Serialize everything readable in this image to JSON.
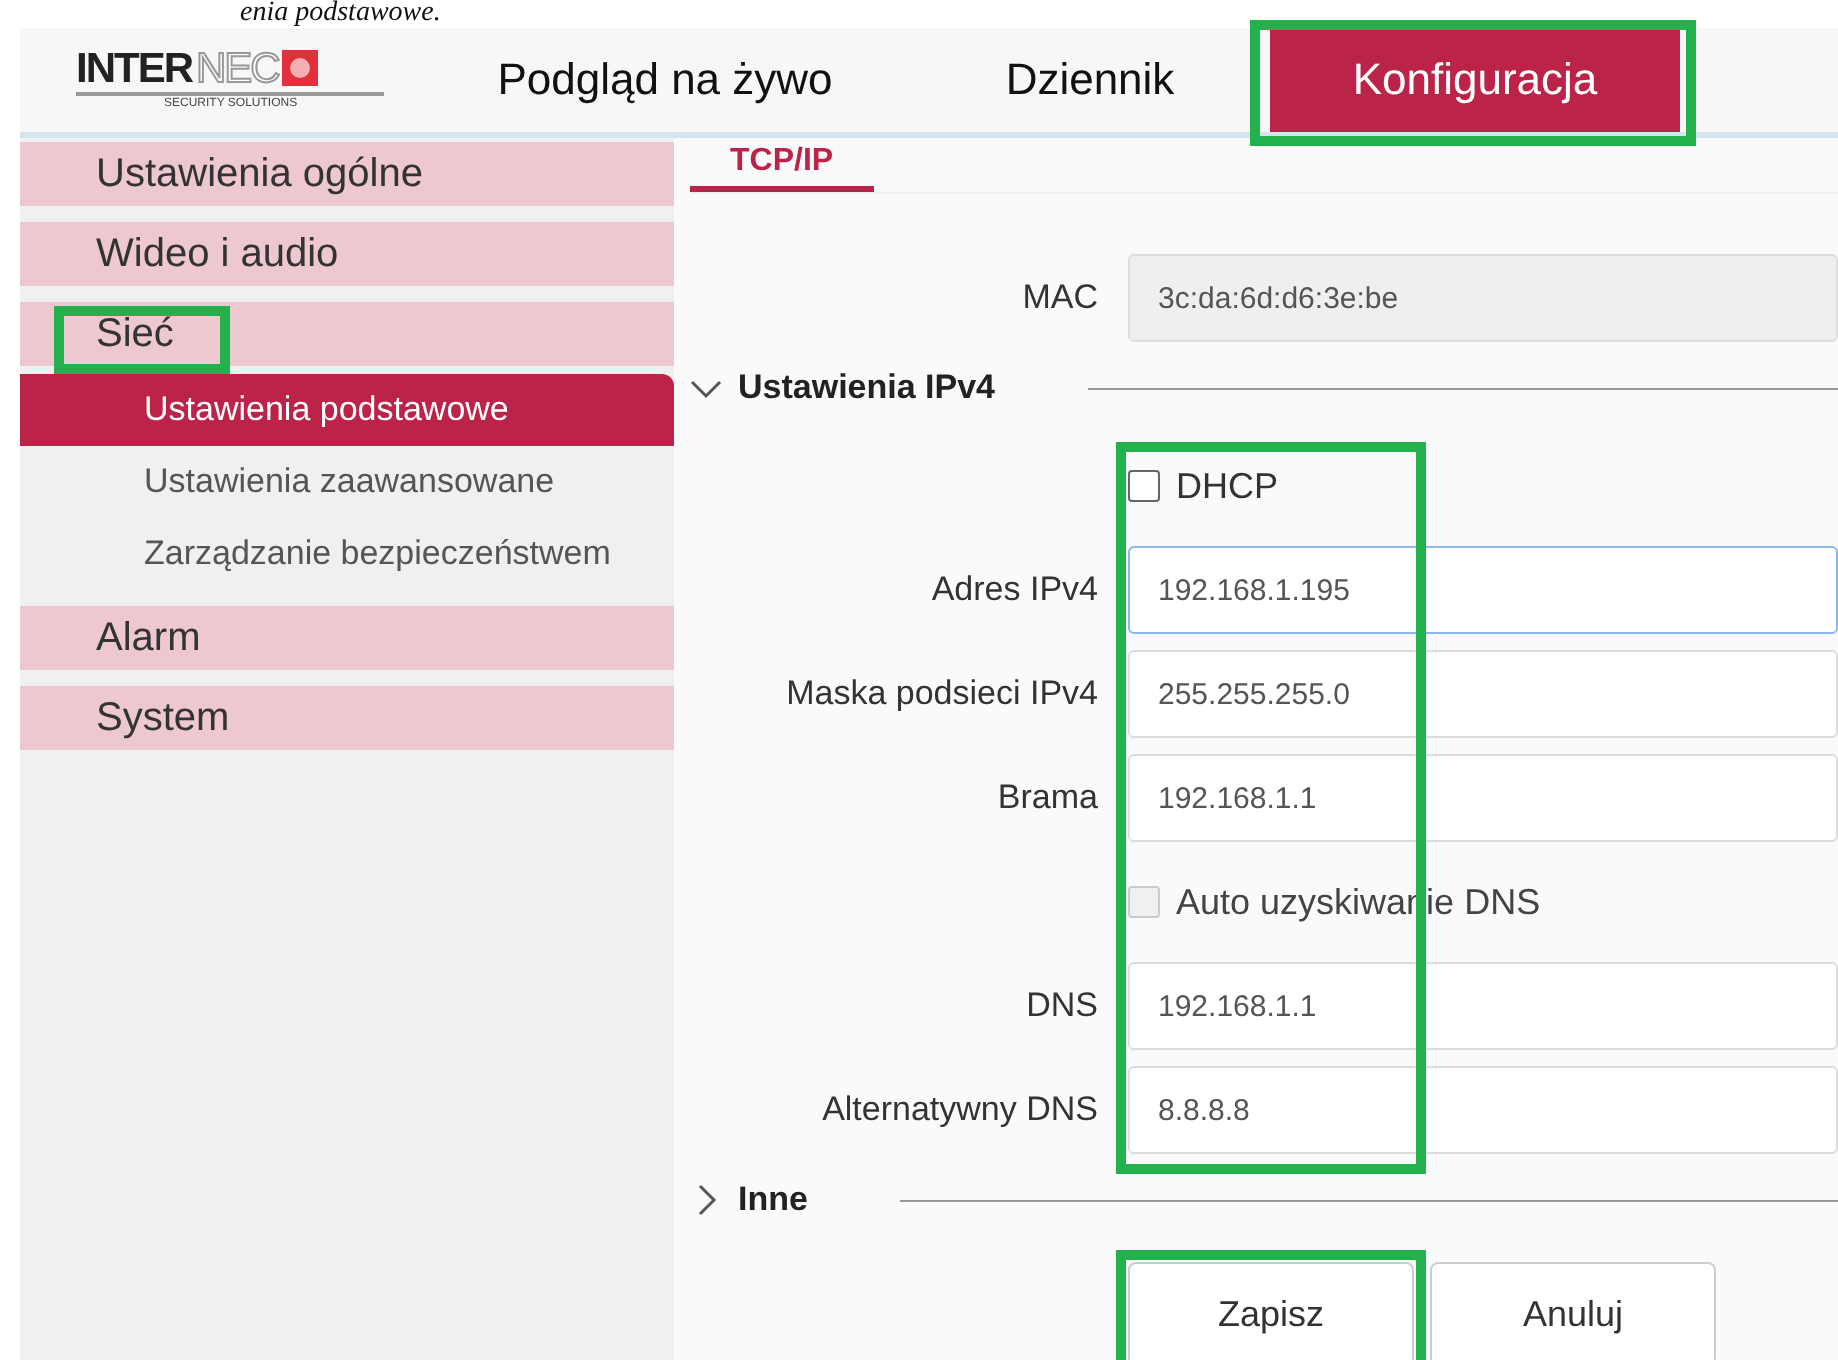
{
  "caption_fragment": "enia podstawowe.",
  "logo": {
    "main": "INTER",
    "accent": "NEC",
    "tagline": "SECURITY SOLUTIONS"
  },
  "nav_tabs": [
    {
      "label": "Podgląd na żywo",
      "selected": false,
      "highlighted": false
    },
    {
      "label": "Dziennik",
      "selected": false,
      "highlighted": false
    },
    {
      "label": "Konfiguracja",
      "selected": true,
      "highlighted": true
    }
  ],
  "sidebar": {
    "items": [
      {
        "label": "Ustawienia ogólne",
        "highlighted": false
      },
      {
        "label": "Wideo i audio",
        "highlighted": false
      },
      {
        "label": "Sieć",
        "highlighted": true,
        "children": [
          {
            "label": "Ustawienia podstawowe",
            "selected": true
          },
          {
            "label": "Ustawienia zaawansowane",
            "selected": false
          },
          {
            "label": "Zarządzanie bezpieczeństwem",
            "selected": false
          }
        ]
      },
      {
        "label": "Alarm",
        "highlighted": false
      },
      {
        "label": "System",
        "highlighted": false
      }
    ]
  },
  "content_tabs": [
    {
      "label": "TCP/IP",
      "selected": true
    }
  ],
  "mac": {
    "label": "MAC",
    "value": "3c:da:6d:d6:3e:be"
  },
  "sections": [
    {
      "title": "Ustawienia IPv4",
      "expanded": true,
      "highlighted": true,
      "rows": [
        {
          "kind": "checkbox",
          "label": "DHCP",
          "checked": false,
          "disabled": false
        },
        {
          "kind": "field",
          "label": "Adres IPv4",
          "value": "192.168.1.195",
          "focused": true
        },
        {
          "kind": "field",
          "label": "Maska podsieci IPv4",
          "value": "255.255.255.0",
          "focused": false
        },
        {
          "kind": "field",
          "label": "Brama",
          "value": "192.168.1.1",
          "focused": false
        },
        {
          "kind": "checkbox",
          "label": "Auto uzyskiwanie DNS",
          "checked": false,
          "disabled": true
        },
        {
          "kind": "field",
          "label": "DNS",
          "value": "192.168.1.1",
          "focused": false
        },
        {
          "kind": "field",
          "label": "Alternatywny DNS",
          "value": "8.8.8.8",
          "focused": false
        }
      ]
    },
    {
      "title": "Inne",
      "expanded": false,
      "highlighted": false
    }
  ],
  "buttons": [
    {
      "label": "Zapisz",
      "highlighted": true
    },
    {
      "label": "Anuluj",
      "highlighted": false
    }
  ]
}
